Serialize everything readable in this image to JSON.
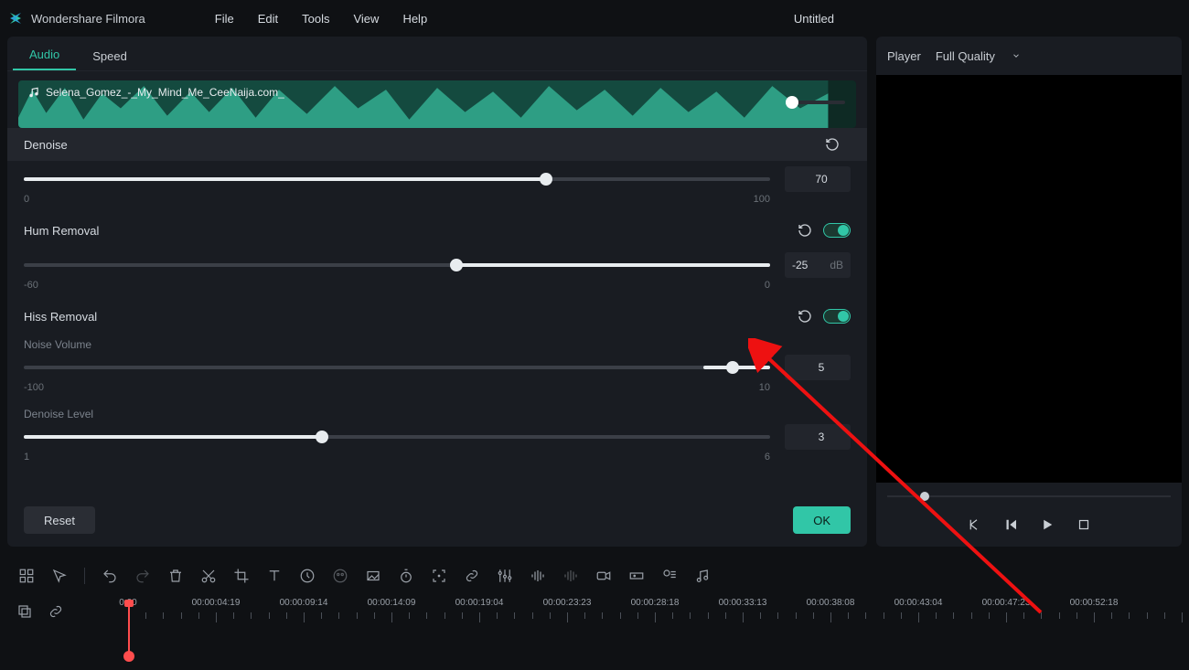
{
  "app": {
    "name": "Wondershare Filmora",
    "document": "Untitled"
  },
  "menu": [
    "File",
    "Edit",
    "Tools",
    "View",
    "Help"
  ],
  "panel": {
    "tabs": {
      "audio": "Audio",
      "speed": "Speed"
    },
    "clip_name": "Selena_Gomez_-_My_Mind_Me_CeeNaija.com_",
    "denoise": {
      "title": "Denoise",
      "value": "70",
      "min": "0",
      "max": "100",
      "pct": 70
    },
    "hum": {
      "title": "Hum Removal",
      "value": "-25",
      "unit": "dB",
      "min": "-60",
      "max": "0",
      "pct": 58
    },
    "hiss": {
      "title": "Hiss Removal",
      "noise_label": "Noise Volume",
      "noise_value": "5",
      "noise_min": "-100",
      "noise_max": "10",
      "noise_pct": 95,
      "den_label": "Denoise Level",
      "den_value": "3",
      "den_min": "1",
      "den_max": "6",
      "den_pct": 40
    },
    "reset_btn": "Reset",
    "ok_btn": "OK"
  },
  "player": {
    "label": "Player",
    "quality": "Full Quality"
  },
  "timeline": {
    "current": "0:00",
    "marks": [
      "00:00:04:19",
      "00:00:09:14",
      "00:00:14:09",
      "00:00:19:04",
      "00:00:23:23",
      "00:00:28:18",
      "00:00:33:13",
      "00:00:38:08",
      "00:00:43:04",
      "00:00:47:23",
      "00:00:52:18"
    ]
  }
}
